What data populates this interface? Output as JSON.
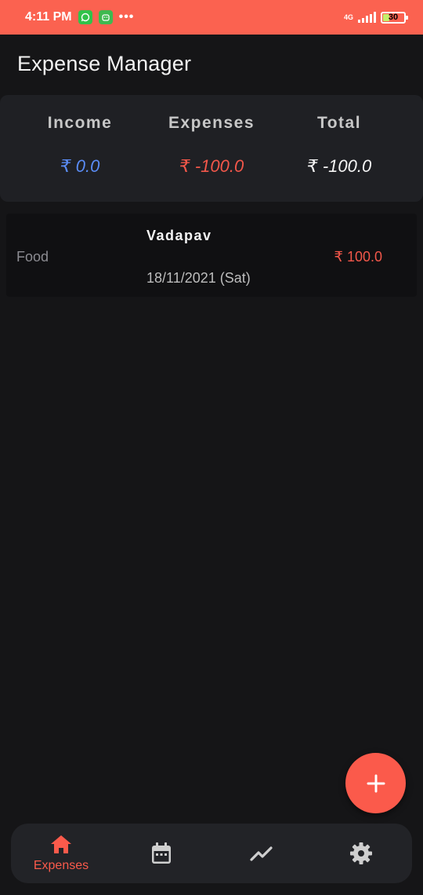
{
  "status_bar": {
    "time": "4:11 PM",
    "dots": "•••",
    "network": "4G",
    "battery": "30"
  },
  "header": {
    "title": "Expense Manager"
  },
  "summary": {
    "income_label": "Income",
    "income_value": "₹ 0.0",
    "expenses_label": "Expenses",
    "expenses_value": "₹ -100.0",
    "total_label": "Total",
    "total_value": "₹ -100.0"
  },
  "transactions": [
    {
      "category": "Food",
      "title": "Vadapav",
      "date": "18/11/2021 (Sat)",
      "amount": "₹ 100.0"
    }
  ],
  "bottom_nav": {
    "items": [
      {
        "label": "Expenses",
        "icon": "home-icon",
        "active": true
      },
      {
        "label": "",
        "icon": "calendar-icon",
        "active": false
      },
      {
        "label": "",
        "icon": "trending-icon",
        "active": false
      },
      {
        "label": "",
        "icon": "gear-icon",
        "active": false
      }
    ]
  },
  "colors": {
    "accent": "#fb5a4b",
    "income": "#5a8cf5",
    "expense": "#f2574a",
    "background": "#151517"
  }
}
